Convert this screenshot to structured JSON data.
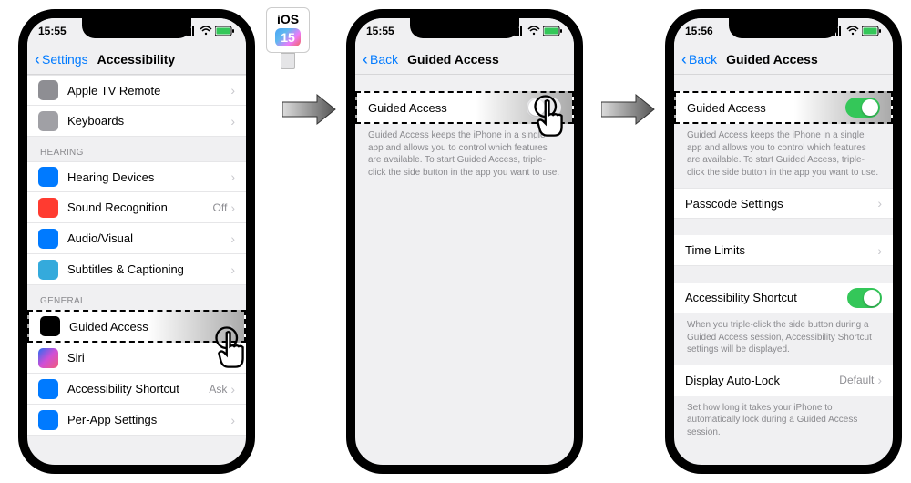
{
  "ios_badge": {
    "os": "iOS",
    "version": "15"
  },
  "screen1": {
    "time": "15:55",
    "back": "Settings",
    "title": "Accessibility",
    "rows_top": [
      {
        "label": "Apple TV Remote",
        "icon_bg": "i-gray"
      },
      {
        "label": "Keyboards",
        "icon_bg": "i-gray2"
      }
    ],
    "hearing_label": "HEARING",
    "rows_hearing": [
      {
        "label": "Hearing Devices",
        "icon_bg": "i-blue"
      },
      {
        "label": "Sound Recognition",
        "icon_bg": "i-red",
        "value": "Off"
      },
      {
        "label": "Audio/Visual",
        "icon_bg": "i-blue"
      },
      {
        "label": "Subtitles & Captioning",
        "icon_bg": "i-cyan"
      }
    ],
    "general_label": "GENERAL",
    "rows_general": [
      {
        "label": "Guided Access",
        "icon_bg": "i-black",
        "highlight": true
      },
      {
        "label": "Siri",
        "icon_bg": "i-siri"
      },
      {
        "label": "Accessibility Shortcut",
        "icon_bg": "i-blue",
        "value": "Ask"
      },
      {
        "label": "Per-App Settings",
        "icon_bg": "i-blue"
      }
    ]
  },
  "screen2": {
    "time": "15:55",
    "back": "Back",
    "title": "Guided Access",
    "toggle_row": {
      "label": "Guided Access",
      "on": false
    },
    "desc": "Guided Access keeps the iPhone in a single app and allows you to control which features are available. To start Guided Access, triple-click the side button in the app you want to use."
  },
  "screen3": {
    "time": "15:56",
    "back": "Back",
    "title": "Guided Access",
    "toggle_row": {
      "label": "Guided Access",
      "on": true
    },
    "desc": "Guided Access keeps the iPhone in a single app and allows you to control which features are available. To start Guided Access, triple-click the side button in the app you want to use.",
    "rows_mid": [
      {
        "label": "Passcode Settings"
      },
      {
        "label": "Time Limits"
      }
    ],
    "shortcut": {
      "label": "Accessibility Shortcut",
      "on": true
    },
    "shortcut_desc": "When you triple-click the side button during a Guided Access session, Accessibility Shortcut settings will be displayed.",
    "autolock": {
      "label": "Display Auto-Lock",
      "value": "Default"
    },
    "autolock_desc": "Set how long it takes your iPhone to automatically lock during a Guided Access session."
  }
}
